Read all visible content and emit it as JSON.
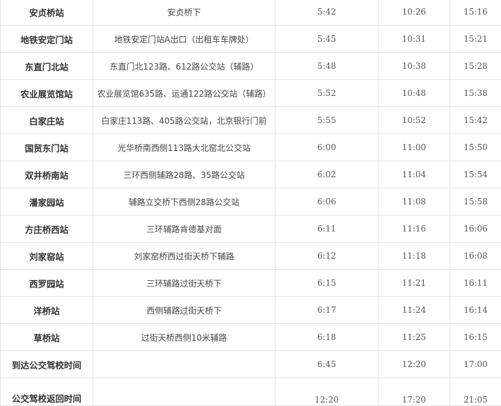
{
  "rows": [
    {
      "stop": "安贞桥站",
      "location": "安贞桥下",
      "t1": "5:42",
      "t2": "10:26",
      "t3": "15:16"
    },
    {
      "stop": "地铁安定门站",
      "location": "地铁安定门站A出口（出租车车牌处）",
      "t1": "5:45",
      "t2": "10:31",
      "t3": "15:21"
    },
    {
      "stop": "东直门北站",
      "location": "东直门北123路、612路公交站（辅路）",
      "t1": "5:48",
      "t2": "10:38",
      "t3": "15:28"
    },
    {
      "stop": "农业展览馆站",
      "location": "农业展览馆635路、运通122路公交站（辅路）",
      "t1": "5:52",
      "t2": "10:48",
      "t3": "15:38"
    },
    {
      "stop": "白家庄站",
      "location": "白家庄113路、405路公交站，北京银行门前",
      "t1": "5:55",
      "t2": "10:52",
      "t3": "15:42"
    },
    {
      "stop": "国贸东门站",
      "location": "光华桥南西侧113路大北窑北公交站",
      "t1": "6:00",
      "t2": "11:00",
      "t3": "15:50"
    },
    {
      "stop": "双井桥南站",
      "location": "三环西侧辅路28路、35路公交站",
      "t1": "6:02",
      "t2": "11:04",
      "t3": "15:54"
    },
    {
      "stop": "潘家园站",
      "location": "辅路立交桥下西侧28路公交站",
      "t1": "6:06",
      "t2": "11:08",
      "t3": "15:58"
    },
    {
      "stop": "方庄桥西站",
      "location": "三环辅路肯德基对面",
      "t1": "6:11",
      "t2": "11:16",
      "t3": "16:06"
    },
    {
      "stop": "刘家窑站",
      "location": "刘家窑桥西过街天桥下辅路",
      "t1": "6:12",
      "t2": "11:18",
      "t3": "16:08"
    },
    {
      "stop": "西罗园站",
      "location": "三环辅路过街天桥下",
      "t1": "6:15",
      "t2": "11:21",
      "t3": "16:11"
    },
    {
      "stop": "洋桥站",
      "location": "西侧辅路过街天桥下",
      "t1": "6:17",
      "t2": "11:24",
      "t3": "16:14"
    },
    {
      "stop": "草桥站",
      "location": "过街天桥西侧10米辅路",
      "t1": "6:18",
      "t2": "11:25",
      "t3": "16:15"
    },
    {
      "stop": "到达公交驾校时间",
      "location": "",
      "t1": "6:45",
      "t2": "12:20",
      "t3": "17:00"
    },
    {
      "stop": "公交驾校返回时间",
      "location": "",
      "t1": "12:20",
      "t2": "17:20",
      "t3": "21:05"
    }
  ]
}
